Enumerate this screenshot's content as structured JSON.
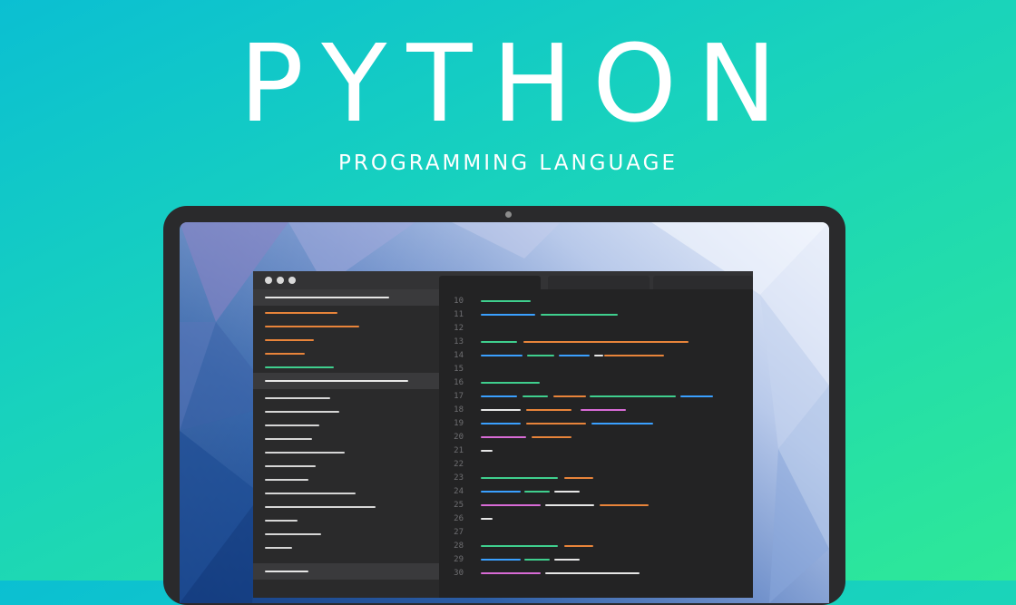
{
  "hero": {
    "title": "PYTHON",
    "subtitle": "PROGRAMMING LANGUAGE"
  },
  "colors": {
    "background_start": "#0bbfd2",
    "background_end": "#2ee898",
    "bezel": "#2a2a2c",
    "editor_bg": "#232324",
    "sidebar_bg": "#2a2a2b",
    "syntax_green": "#3fcf8e",
    "syntax_blue": "#3aa0ff",
    "syntax_orange": "#e8843a",
    "syntax_pink": "#d86bd6",
    "syntax_white": "#e6e6e6"
  },
  "editor": {
    "window_controls": [
      "dot",
      "dot",
      "dot"
    ],
    "line_numbers": [
      "10",
      "11",
      "12",
      "13",
      "14",
      "15",
      "16",
      "17",
      "18",
      "19",
      "20",
      "21",
      "22",
      "23",
      "24",
      "25",
      "26",
      "27",
      "28",
      "29",
      "30"
    ]
  }
}
